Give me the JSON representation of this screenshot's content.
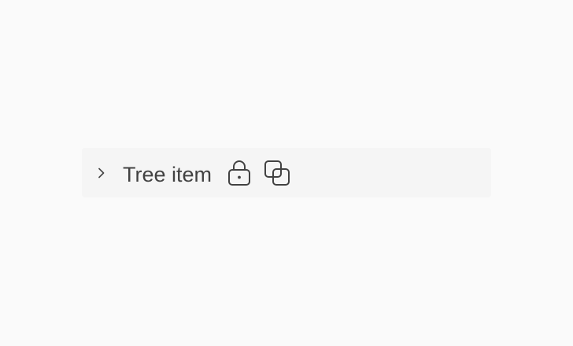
{
  "tree": {
    "item": {
      "label": "Tree item",
      "expanded": false,
      "chevron_icon": "chevron-right-icon",
      "action_icons": [
        "lock-closed-icon",
        "copy-icon"
      ]
    }
  },
  "colors": {
    "background": "#fafafa",
    "item_background": "#f5f5f5",
    "text": "#424242",
    "icon": "#424242"
  }
}
